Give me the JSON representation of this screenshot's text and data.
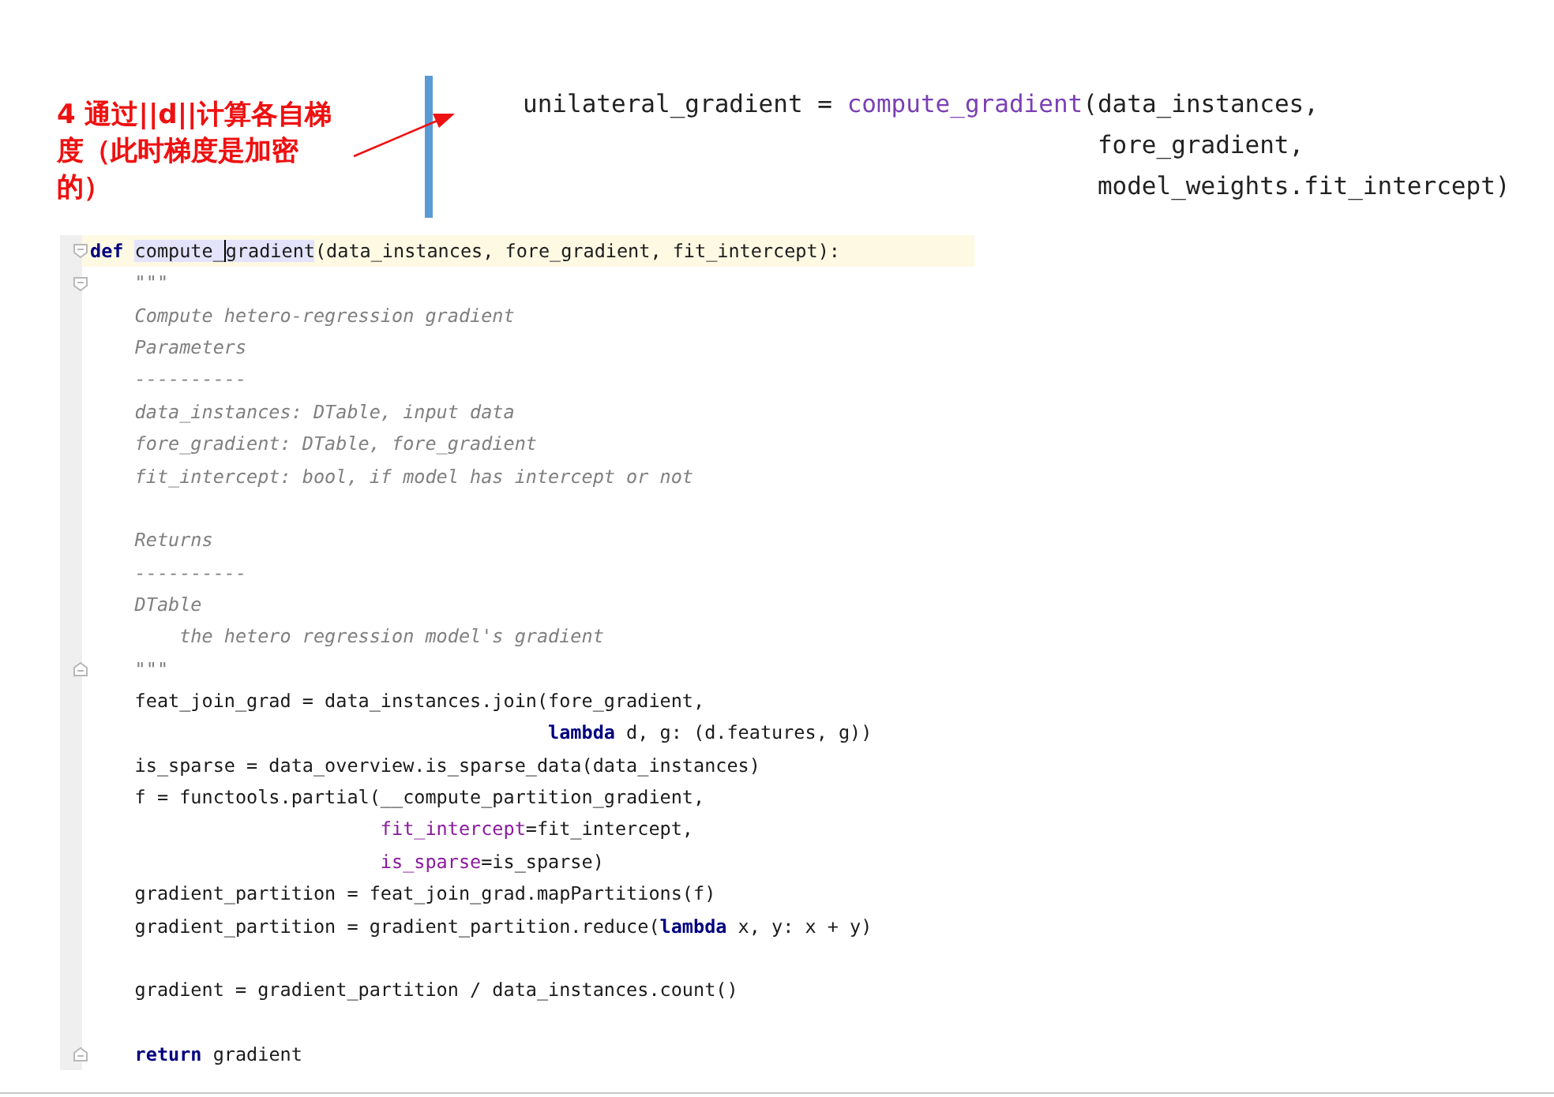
{
  "annotation": {
    "text": "4 通过||d||计算各自梯度（此时梯度是加密的）"
  },
  "snippet": {
    "lines": [
      {
        "tokens": [
          {
            "kind": "plain",
            "text": "unilateral_gradient = "
          },
          {
            "kind": "function",
            "text": "compute_gradient"
          },
          {
            "kind": "plain",
            "text": "(data_instances,"
          }
        ]
      },
      {
        "tokens": [
          {
            "kind": "plain",
            "text": "                                       fore_gradient,"
          }
        ]
      },
      {
        "tokens": [
          {
            "kind": "plain",
            "text": "                                       model_weights.fit_intercept)"
          }
        ]
      }
    ]
  },
  "editor": {
    "lines": [
      {
        "kind": "code",
        "current": true,
        "fold_start": true,
        "fold_end": false,
        "tokens": [
          {
            "kind": "keyword",
            "text": "def "
          },
          {
            "kind": "highlighted",
            "text": "compute_"
          },
          {
            "kind": "highlighted",
            "text": "gradient",
            "caret_before": true
          },
          {
            "kind": "plain",
            "text": "(data_instances, fore_gradient, fit_intercept):"
          }
        ]
      },
      {
        "kind": "code",
        "current": false,
        "fold_start": true,
        "fold_end": false,
        "tokens": [
          {
            "kind": "docstring",
            "text": "    \"\"\""
          }
        ]
      },
      {
        "kind": "code",
        "current": false,
        "fold_start": false,
        "fold_end": false,
        "tokens": [
          {
            "kind": "docstring",
            "text": "    Compute hetero-regression gradient"
          }
        ]
      },
      {
        "kind": "code",
        "current": false,
        "fold_start": false,
        "fold_end": false,
        "tokens": [
          {
            "kind": "docstring",
            "text": "    Parameters"
          }
        ]
      },
      {
        "kind": "code",
        "current": false,
        "fold_start": false,
        "fold_end": false,
        "tokens": [
          {
            "kind": "docstring",
            "text": "    ----------"
          }
        ]
      },
      {
        "kind": "code",
        "current": false,
        "fold_start": false,
        "fold_end": false,
        "tokens": [
          {
            "kind": "docstring",
            "text": "    data_instances: DTable, input data"
          }
        ]
      },
      {
        "kind": "code",
        "current": false,
        "fold_start": false,
        "fold_end": false,
        "tokens": [
          {
            "kind": "docstring",
            "text": "    fore_gradient: DTable, fore_gradient"
          }
        ]
      },
      {
        "kind": "code",
        "current": false,
        "fold_start": false,
        "fold_end": false,
        "tokens": [
          {
            "kind": "docstring",
            "text": "    fit_intercept: bool, if model has intercept or not"
          }
        ]
      },
      {
        "kind": "blank"
      },
      {
        "kind": "code",
        "current": false,
        "fold_start": false,
        "fold_end": false,
        "tokens": [
          {
            "kind": "docstring",
            "text": "    Returns"
          }
        ]
      },
      {
        "kind": "code",
        "current": false,
        "fold_start": false,
        "fold_end": false,
        "tokens": [
          {
            "kind": "docstring",
            "text": "    ----------"
          }
        ]
      },
      {
        "kind": "code",
        "current": false,
        "fold_start": false,
        "fold_end": false,
        "tokens": [
          {
            "kind": "docstring",
            "text": "    DTable"
          }
        ]
      },
      {
        "kind": "code",
        "current": false,
        "fold_start": false,
        "fold_end": false,
        "tokens": [
          {
            "kind": "docstring",
            "text": "        the hetero regression model's gradient"
          }
        ]
      },
      {
        "kind": "code",
        "current": false,
        "fold_start": false,
        "fold_end": true,
        "tokens": [
          {
            "kind": "docstring",
            "text": "    \"\"\""
          }
        ]
      },
      {
        "kind": "code",
        "current": false,
        "fold_start": false,
        "fold_end": false,
        "tokens": [
          {
            "kind": "plain",
            "text": "    feat_join_grad = data_instances.join(fore_gradient,"
          }
        ]
      },
      {
        "kind": "code",
        "current": false,
        "fold_start": false,
        "fold_end": false,
        "tokens": [
          {
            "kind": "keyword",
            "text": "                                         lambda"
          },
          {
            "kind": "plain",
            "text": " d, g: (d.features, g))"
          }
        ]
      },
      {
        "kind": "code",
        "current": false,
        "fold_start": false,
        "fold_end": false,
        "tokens": [
          {
            "kind": "plain",
            "text": "    is_sparse = data_overview.is_sparse_data(data_instances)"
          }
        ]
      },
      {
        "kind": "code",
        "current": false,
        "fold_start": false,
        "fold_end": false,
        "tokens": [
          {
            "kind": "plain",
            "text": "    f = functools.partial(__compute_partition_gradient,"
          }
        ]
      },
      {
        "kind": "code",
        "current": false,
        "fold_start": false,
        "fold_end": false,
        "tokens": [
          {
            "kind": "argument",
            "text": "                          fit_intercept"
          },
          {
            "kind": "plain",
            "text": "=fit_intercept,"
          }
        ]
      },
      {
        "kind": "code",
        "current": false,
        "fold_start": false,
        "fold_end": false,
        "tokens": [
          {
            "kind": "argument",
            "text": "                          is_sparse"
          },
          {
            "kind": "plain",
            "text": "=is_sparse)"
          }
        ]
      },
      {
        "kind": "code",
        "current": false,
        "fold_start": false,
        "fold_end": false,
        "tokens": [
          {
            "kind": "plain",
            "text": "    gradient_partition = feat_join_grad.mapPartitions(f)"
          }
        ]
      },
      {
        "kind": "code",
        "current": false,
        "fold_start": false,
        "fold_end": false,
        "tokens": [
          {
            "kind": "plain",
            "text": "    gradient_partition = gradient_partition.reduce("
          },
          {
            "kind": "keyword",
            "text": "lambda"
          },
          {
            "kind": "plain",
            "text": " x, y: x + y)"
          }
        ]
      },
      {
        "kind": "blank"
      },
      {
        "kind": "code",
        "current": false,
        "fold_start": false,
        "fold_end": false,
        "tokens": [
          {
            "kind": "plain",
            "text": "    gradient = gradient_partition / data_instances.count()"
          }
        ]
      },
      {
        "kind": "blank"
      },
      {
        "kind": "code",
        "current": false,
        "fold_start": false,
        "fold_end": true,
        "tokens": [
          {
            "kind": "keyword",
            "text": "    return"
          },
          {
            "kind": "plain",
            "text": " gradient"
          }
        ]
      }
    ]
  }
}
